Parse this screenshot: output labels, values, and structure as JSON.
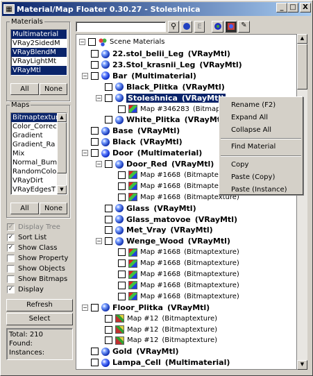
{
  "window": {
    "title": "Material/Map Floater 0.30.27 - Stoleshnica"
  },
  "title_buttons": {
    "minimize": "_",
    "maximize": "□",
    "close": "X"
  },
  "materials_panel": {
    "label": "Materials",
    "items": [
      "Multimaterial",
      "VRay2SidedM",
      "VRayBlendM",
      "VRayLightMt",
      "VRayMtl"
    ],
    "selected": [
      "Multimaterial",
      "VRayBlendM",
      "VRayMtl"
    ],
    "all_label": "All",
    "none_label": "None"
  },
  "maps_panel": {
    "label": "Maps",
    "items": [
      "Bitmaptexture",
      "Color_Correc",
      "Gradient",
      "Gradient_Ra",
      "Mix",
      "Normal_Bum",
      "RandomColo",
      "VRayDirt",
      "VRayEdgesT"
    ],
    "selected": [
      "Bitmaptexture"
    ],
    "all_label": "All",
    "none_label": "None"
  },
  "options": [
    {
      "label": "Display Tree",
      "checked": true,
      "disabled": true
    },
    {
      "label": "Sort List",
      "checked": true,
      "disabled": false
    },
    {
      "label": "Show Class",
      "checked": true,
      "disabled": false
    },
    {
      "label": "Show Property",
      "checked": false,
      "disabled": false
    },
    {
      "label": "Show Objects",
      "checked": false,
      "disabled": false
    },
    {
      "label": "Show Bitmaps",
      "checked": false,
      "disabled": false
    },
    {
      "label": "Display",
      "checked": true,
      "disabled": false
    }
  ],
  "refresh_label": "Refresh",
  "select_label": "Select",
  "stats": {
    "total": "Total: 210",
    "found": "Found:",
    "instances": "Instances:"
  },
  "toolbar": {
    "search_value": "",
    "e_button": "E"
  },
  "tree": {
    "root": "Scene Materials",
    "rows": [
      {
        "level": 1,
        "kind": "mat",
        "name": "22.stol_belii_Leg",
        "cls": "(VRayMtl)"
      },
      {
        "level": 1,
        "kind": "mat",
        "name": "23.Stol_krasnii_Leg",
        "cls": "(VRayMtl)"
      },
      {
        "level": 1,
        "kind": "multi",
        "name": "Bar",
        "cls": "(Multimaterial)",
        "expander": "-"
      },
      {
        "level": 2,
        "kind": "mat",
        "name": "Black_Plitka",
        "cls": "(VRayMtl)"
      },
      {
        "level": 2,
        "kind": "mat",
        "name": "Stoleshnica",
        "cls": "(VRayMtl)",
        "selected": true,
        "expander": "-"
      },
      {
        "level": 3,
        "kind": "map",
        "name": "Map #346283",
        "cls": "(Bitmaptexture)"
      },
      {
        "level": 2,
        "kind": "mat",
        "name": "White_Plitka",
        "cls": "(VRayMtl)"
      },
      {
        "level": 1,
        "kind": "mat",
        "name": "Base",
        "cls": "(VRayMtl)"
      },
      {
        "level": 1,
        "kind": "mat",
        "name": "Black",
        "cls": "(VRayMtl)"
      },
      {
        "level": 1,
        "kind": "multi",
        "name": "Door",
        "cls": "(Multimaterial)",
        "expander": "-"
      },
      {
        "level": 2,
        "kind": "mat",
        "name": "Door_Red",
        "cls": "(VRayMtl)",
        "expander": "-"
      },
      {
        "level": 3,
        "kind": "map",
        "name": "Map #1668",
        "cls": "(Bitmaptexture)"
      },
      {
        "level": 3,
        "kind": "map",
        "name": "Map #1668",
        "cls": "(Bitmaptexture)"
      },
      {
        "level": 3,
        "kind": "map",
        "name": "Map #1668",
        "cls": "(Bitmaptexture)"
      },
      {
        "level": 2,
        "kind": "mat",
        "name": "Glass",
        "cls": "(VRayMtl)"
      },
      {
        "level": 2,
        "kind": "mat",
        "name": "Glass_matovoe",
        "cls": "(VRayMtl)"
      },
      {
        "level": 2,
        "kind": "mat",
        "name": "Met_Vray",
        "cls": "(VRayMtl)"
      },
      {
        "level": 2,
        "kind": "mat",
        "name": "Wenge_Wood",
        "cls": "(VRayMtl)",
        "expander": "-"
      },
      {
        "level": 3,
        "kind": "map",
        "name": "Map #1668",
        "cls": "(Bitmaptexture)"
      },
      {
        "level": 3,
        "kind": "map",
        "name": "Map #1668",
        "cls": "(Bitmaptexture)"
      },
      {
        "level": 3,
        "kind": "map",
        "name": "Map #1668",
        "cls": "(Bitmaptexture)"
      },
      {
        "level": 3,
        "kind": "map",
        "name": "Map #1668",
        "cls": "(Bitmaptexture)"
      },
      {
        "level": 3,
        "kind": "map",
        "name": "Map #1668",
        "cls": "(Bitmaptexture)"
      },
      {
        "level": 1,
        "kind": "mat",
        "name": "Floor_Plitka",
        "cls": "(VRayMtl)",
        "expander": "-"
      },
      {
        "level": 2,
        "kind": "map2",
        "name": "Map #12",
        "cls": "(Bitmaptexture)"
      },
      {
        "level": 2,
        "kind": "map2",
        "name": "Map #12",
        "cls": "(Bitmaptexture)"
      },
      {
        "level": 2,
        "kind": "map2",
        "name": "Map #12",
        "cls": "(Bitmaptexture)"
      },
      {
        "level": 1,
        "kind": "mat",
        "name": "Gold",
        "cls": "(VRayMtl)"
      },
      {
        "level": 1,
        "kind": "multi",
        "name": "Lampa_Cell",
        "cls": "(Multimaterial)"
      }
    ]
  },
  "context_menu": {
    "items": [
      "Rename (F2)",
      "Expand All",
      "Collapse All",
      "Find Material",
      "Copy",
      "Paste (Copy)",
      "Paste (Instance)"
    ]
  }
}
